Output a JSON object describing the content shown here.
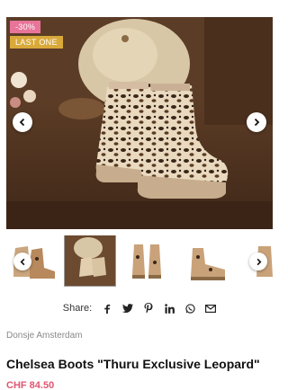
{
  "gallery": {
    "badges": {
      "sale": "-30%",
      "last": "LAST ONE"
    },
    "prev_icon": "chevron-left-icon",
    "next_icon": "chevron-right-icon"
  },
  "thumbnails": {
    "count": 5,
    "active_index": 1
  },
  "share": {
    "label": "Share:",
    "networks": [
      "facebook",
      "twitter",
      "pinterest",
      "linkedin",
      "whatsapp",
      "email"
    ]
  },
  "product": {
    "brand": "Donsje Amsterdam",
    "title": "Chelsea Boots \"Thuru Exclusive Leopard\"",
    "price": "CHF 84.50"
  },
  "colors": {
    "accent_pink": "#e8749a",
    "accent_gold": "#d9a93a",
    "price": "#e0566f"
  }
}
